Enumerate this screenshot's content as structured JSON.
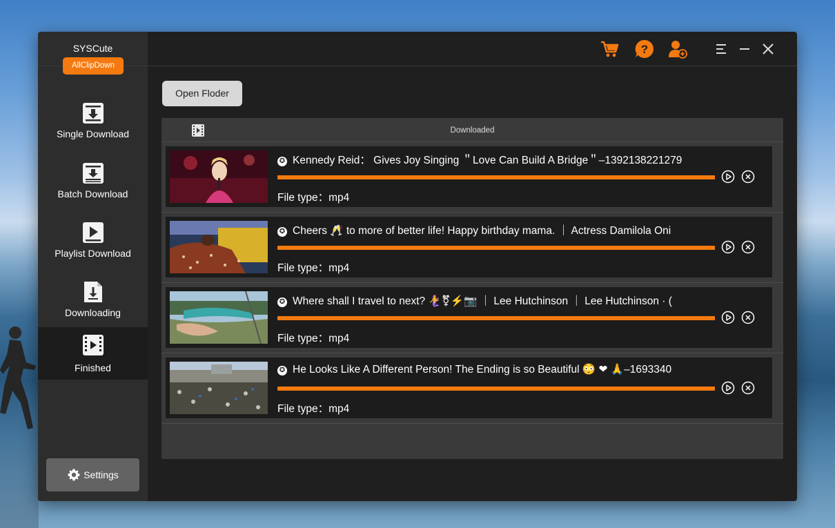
{
  "brand": {
    "title": "SYSCute",
    "badge": "AllClipDown"
  },
  "nav": [
    {
      "label": "Single Download",
      "icon": "single-download-icon"
    },
    {
      "label": "Batch Download",
      "icon": "batch-download-icon"
    },
    {
      "label": "Playlist Download",
      "icon": "playlist-icon"
    },
    {
      "label": "Downloading",
      "icon": "downloading-icon"
    },
    {
      "label": "Finished",
      "icon": "film-icon",
      "active": true
    }
  ],
  "settings": {
    "label": "Settings"
  },
  "toolbar": {
    "icons": [
      "cart-icon",
      "help-icon",
      "add-user-icon",
      "menu-icon",
      "minimize-icon",
      "close-icon"
    ]
  },
  "main": {
    "open_folder_label": "Open Floder",
    "panel_title": "Downloaded",
    "items": [
      {
        "title": "Kennedy Reid： Gives Joy Singing ＂Love Can Build A Bridge＂–1392138221279",
        "file_type": "File type：mp4",
        "progress": 1.0
      },
      {
        "title": "Cheers 🥂 to more of better life! Happy birthday mama. ｜ Actress Damilola Oni",
        "file_type": "File type：mp4",
        "progress": 1.0
      },
      {
        "title": "Where shall I travel to next? 🧜‍♀️⚧⚡📷 ｜ Lee Hutchinson ｜ Lee Hutchinson · (",
        "file_type": "File type：mp4",
        "progress": 1.0
      },
      {
        "title": "He Looks Like A Different Person! The Ending is so Beautiful 😳 ❤ 🙏–1693340",
        "file_type": "File type：mp4",
        "progress": 1.0
      }
    ]
  },
  "colors": {
    "accent": "#f47a10",
    "sidebar": "#2d2d2d",
    "content": "#1f1f1f",
    "panel": "#3a3a3a"
  }
}
